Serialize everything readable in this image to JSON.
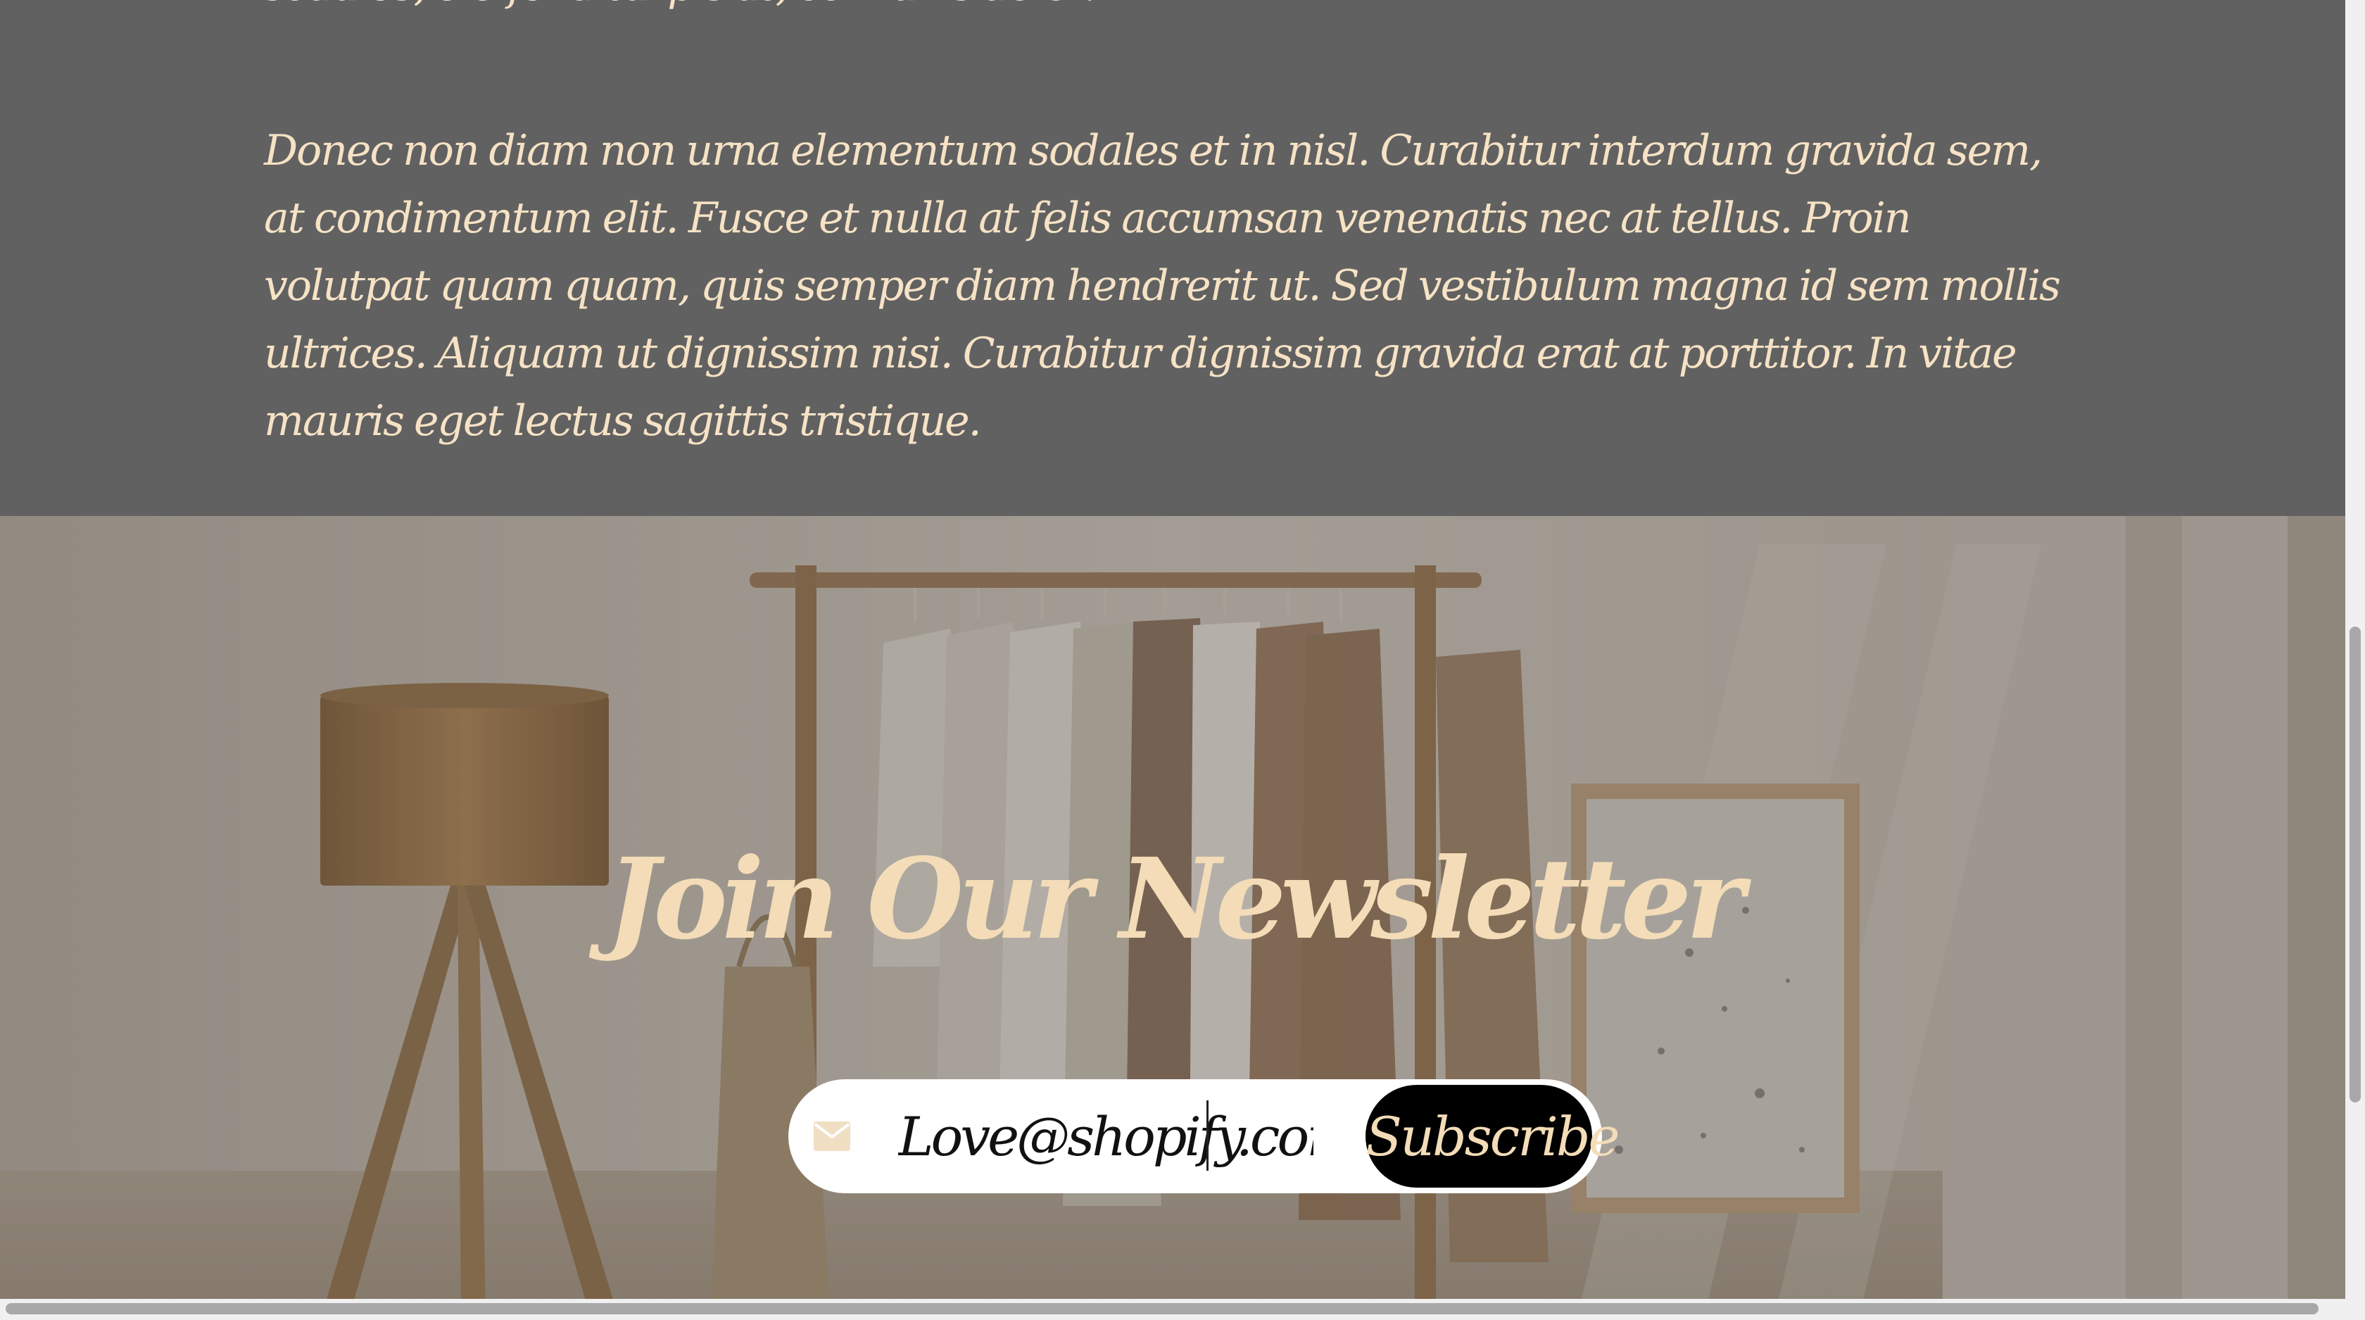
{
  "content": {
    "paragraph_top": "sodales, eleifend turpis at, convallis dolor.",
    "paragraph_main": "Donec non diam non urna elementum sodales et in nisl. Curabitur interdum gravida sem, at condimentum elit. Fusce et nulla at felis accumsan venenatis nec at tellus. Proin volutpat quam quam, quis semper diam hendrerit ut. Sed vestibulum magna id sem mollis ultrices. Aliquam ut dignissim nisi. Curabitur dignissim gravida erat at porttitor. In vitae mauris eget lectus sagittis tristique."
  },
  "newsletter": {
    "title": "Join Our Newsletter",
    "email_value": "Love@shopify.com",
    "subscribe_label": "Subscribe",
    "mail_icon": "envelope-icon",
    "below_text": ""
  },
  "colors": {
    "text_accent": "#f6e2c4",
    "section_background": "#616162",
    "button_background": "#000000",
    "input_background": "#ffffff"
  }
}
